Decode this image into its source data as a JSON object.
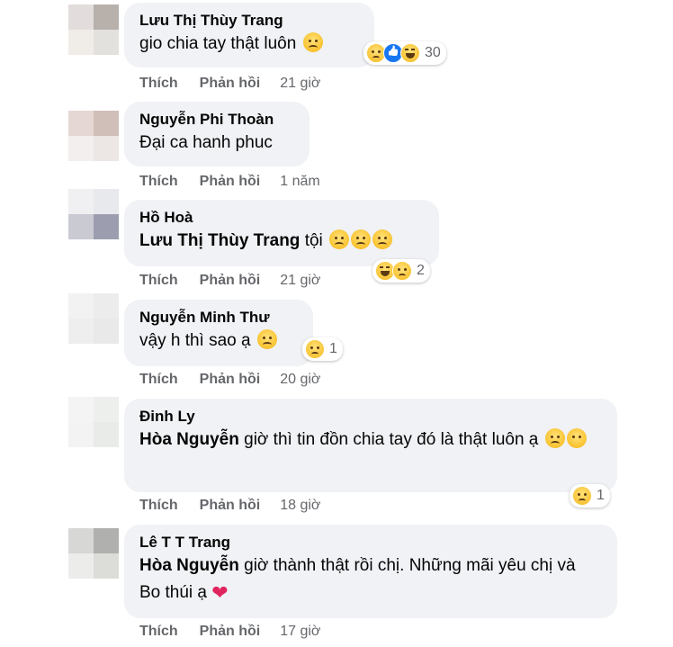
{
  "actions": {
    "like_label": "Thích",
    "reply_label": "Phản hồi"
  },
  "comments": [
    {
      "author": "Lưu Thị Thùy Trang",
      "text": "gio chia tay thật luôn",
      "time": "21 giờ",
      "reaction_count": "30",
      "reaction_icons": [
        "sad-face",
        "like",
        "haha"
      ],
      "avatar_colors": [
        "#e2dddc",
        "#b7b0ab",
        "#f0ede8",
        "#e3e1dd"
      ]
    },
    {
      "author": "Nguyễn Phi Thoàn",
      "text": "Đại ca hanh phuc",
      "time": "1 năm",
      "avatar_colors": [
        "#e5d8d4",
        "#d0bfb9",
        "#f3efee",
        "#ece7e5"
      ]
    },
    {
      "author": "Hồ Hoà",
      "mention": "Lưu Thị Thùy Trang",
      "text": "tội",
      "time": "21 giờ",
      "reaction_count": "2",
      "reaction_icons": [
        "haha",
        "sad-face"
      ],
      "avatar_colors": [
        "#f0f0f2",
        "#e8e9ec",
        "#c9cad2",
        "#9c9eb0"
      ]
    },
    {
      "author": "Nguyễn Minh Thư",
      "text": "vậy h thì sao ạ",
      "time": "20 giờ",
      "reaction_count": "1",
      "reaction_icons": [
        "sad-face"
      ],
      "avatar_colors": [
        "#f2f2f2",
        "#ececec",
        "#eeeeee",
        "#e9e9e9"
      ]
    },
    {
      "author": "Đinh Ly",
      "mention": "Hòa Nguyễn",
      "text": "giờ thì tin đồn chia tay đó là thật luôn ạ",
      "time": "18 giờ",
      "reaction_count": "1",
      "reaction_icons": [
        "sad-face"
      ],
      "avatar_colors": [
        "#f3f4f3",
        "#edefed",
        "#f2f3f2",
        "#e9ebe9"
      ]
    },
    {
      "author": "Lê T T Trang",
      "mention": "Hòa Nguyễn",
      "text": "giờ thành thật rồi chị. Những mãi yêu chị và Bo thúi ạ",
      "time": "17 giờ",
      "avatar_colors": [
        "#d7d8d6",
        "#b0b1ae",
        "#ecedeb",
        "#dcdcd9"
      ]
    }
  ]
}
